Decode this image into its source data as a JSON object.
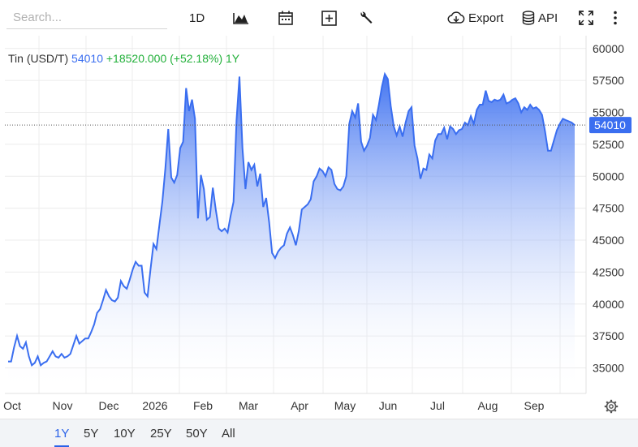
{
  "toolbar": {
    "search_placeholder": "Search...",
    "interval_label": "1D",
    "export_label": "Export",
    "api_label": "API",
    "icons": [
      "chart-type-icon",
      "calendar-icon",
      "add-indicator-icon",
      "wrench-icon",
      "cloud-download-icon",
      "database-icon",
      "fullscreen-icon",
      "more-vertical-icon"
    ]
  },
  "legend": {
    "name": "Tin (USD/T)",
    "price": "54010",
    "change": "+18520.000",
    "percent": "(+52.18%)",
    "period": "1Y"
  },
  "colors": {
    "line": "#3a6ef0",
    "fill_top": "#3a6ef0",
    "fill_bottom": "#ffffff",
    "price_tag": "#3a6ef0",
    "positive": "#22b03a",
    "active_range": "#2a62e8"
  },
  "chart_data": {
    "type": "area",
    "series": [
      {
        "values": [
          35500,
          35500,
          36600,
          37500,
          36700,
          36500,
          37000,
          35900,
          35200,
          35400,
          35900,
          35200,
          35400,
          35500,
          35900,
          36300,
          35900,
          35800,
          36100,
          35800,
          35900,
          36100,
          36800,
          37500,
          36900,
          37100,
          37300,
          37300,
          37800,
          38400,
          39300,
          39600,
          40300,
          41100,
          40600,
          40300,
          40200,
          40500,
          41800,
          41400,
          41200,
          41900,
          42700,
          43300,
          43000,
          43000,
          40900,
          40600,
          42700,
          44700,
          44300,
          46200,
          48000,
          50600,
          53700,
          49900,
          49500,
          50100,
          52200,
          52700,
          56900,
          55100,
          56000,
          54500,
          46700,
          50100,
          49000,
          46600,
          46800,
          49100,
          47400,
          45900,
          45700,
          45900,
          45600,
          46900,
          48000,
          54400,
          57800,
          52200,
          49000,
          51100,
          50500,
          50900,
          49200,
          50200,
          47600,
          48300,
          46400,
          44000,
          43600,
          44100,
          44400,
          44600,
          45500,
          46000,
          45400,
          44600,
          45700,
          47400,
          47600,
          47800,
          48200,
          49600,
          50000,
          50600,
          50400,
          50000,
          50700,
          50500,
          49400,
          49000,
          48900,
          49200,
          50000,
          54100,
          55100,
          54600,
          55700,
          52700,
          52000,
          52400,
          53000,
          54800,
          54400,
          55600,
          57000,
          58000,
          57600,
          55500,
          53900,
          53200,
          53900,
          53100,
          54200,
          55100,
          55400,
          52400,
          51400,
          49800,
          50600,
          50500,
          51700,
          51400,
          52800,
          53300,
          53300,
          53800,
          52900,
          53900,
          53700,
          53300,
          53600,
          53700,
          54200,
          54000,
          54700,
          54100,
          55200,
          55600,
          55600,
          56700,
          55900,
          55800,
          56000,
          55900,
          56000,
          56400,
          55700,
          55800,
          56000,
          56100,
          55700,
          55000,
          55400,
          55200,
          55600,
          55300,
          55400,
          55200,
          54800,
          53500,
          52000,
          52000,
          52800,
          53600,
          54100,
          54500,
          54400,
          54300,
          54200,
          54000
        ]
      }
    ],
    "x_tick_labels": [
      "Oct",
      "Nov",
      "Dec",
      "2026",
      "Feb",
      "Mar",
      "Apr",
      "May",
      "Jun",
      "Jul",
      "Aug",
      "Sep"
    ],
    "y_ticks": [
      35000,
      37500,
      40000,
      42500,
      45000,
      47500,
      50000,
      52500,
      55000,
      57500,
      60000
    ],
    "ylim": [
      33000,
      61000
    ],
    "last_value_label": "54010",
    "last_value": 54010,
    "grid": true,
    "y_axis_position": "right"
  },
  "range": {
    "buttons": [
      "1Y",
      "5Y",
      "10Y",
      "25Y",
      "50Y",
      "All"
    ],
    "active": "1Y"
  }
}
